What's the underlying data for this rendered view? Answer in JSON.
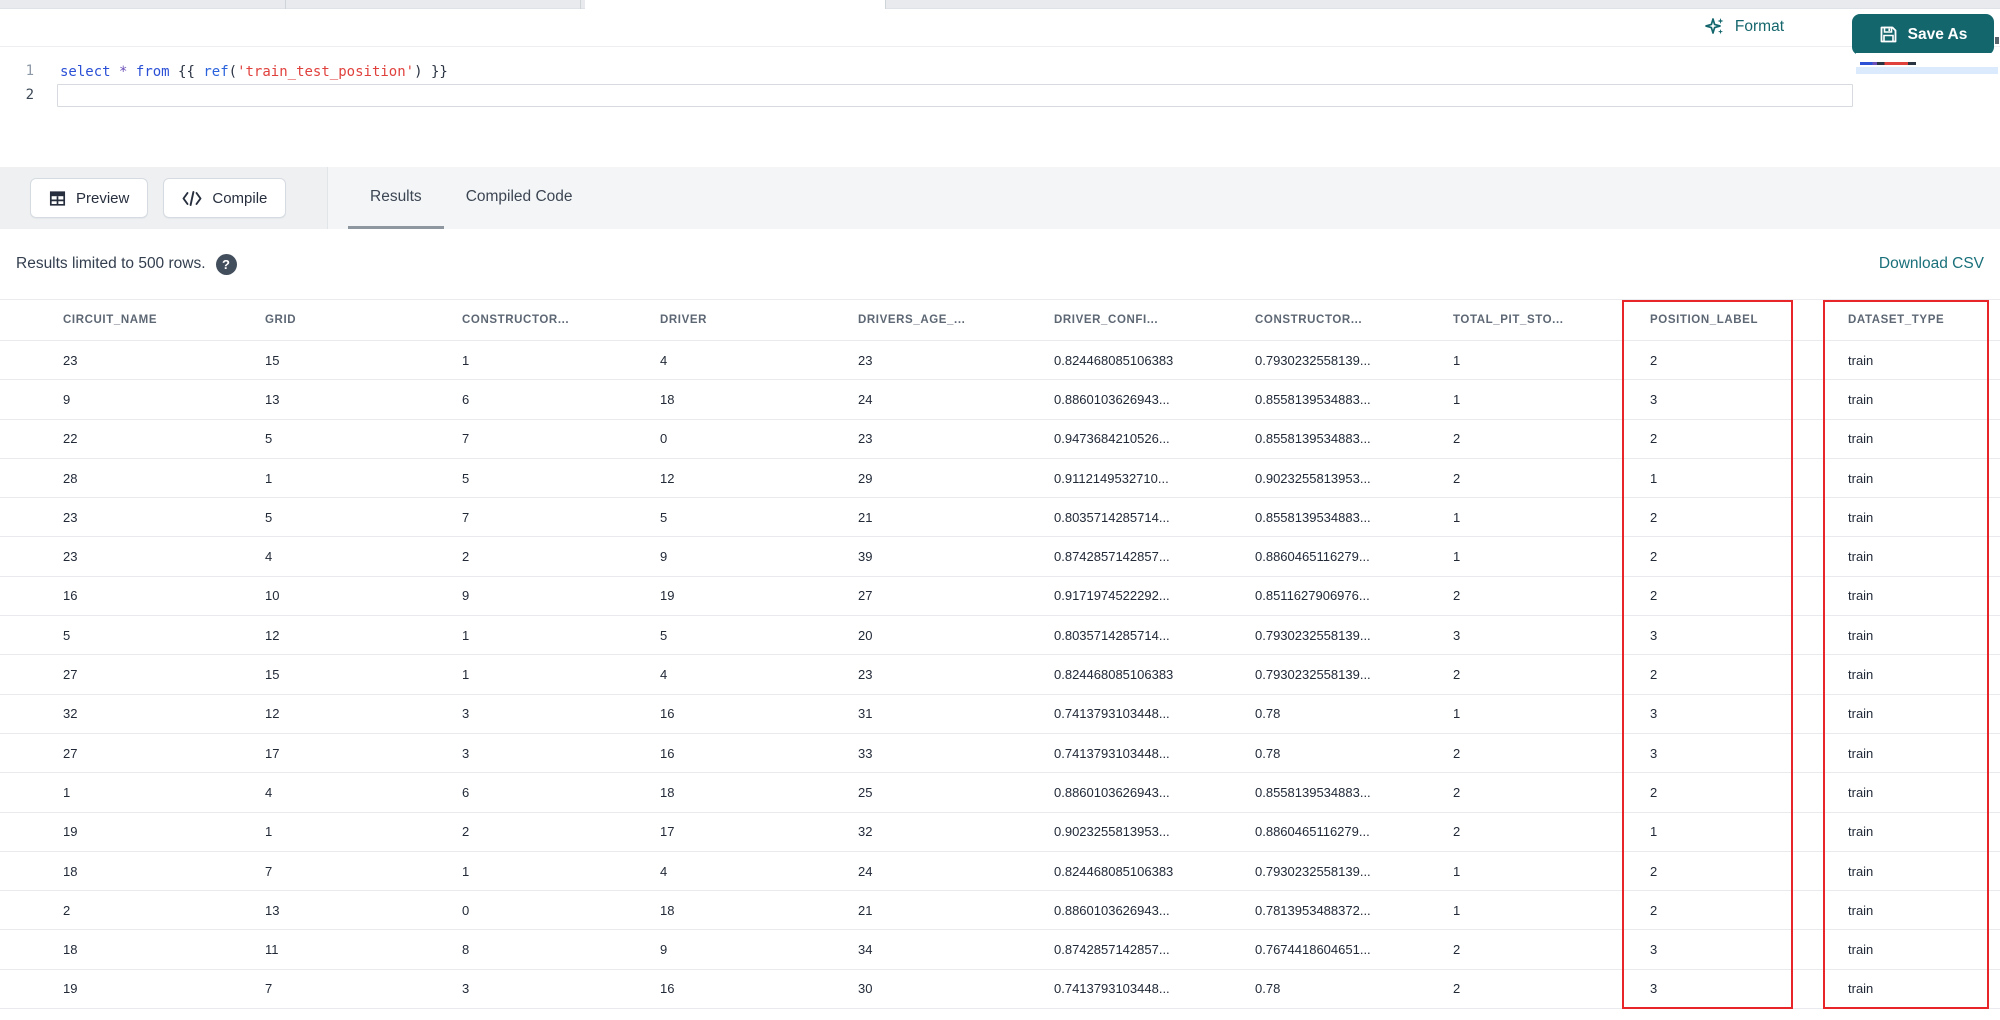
{
  "editor": {
    "line_numbers": [
      "1",
      "2"
    ],
    "code_line": "select * from {{ ref('train_test_position') }}",
    "line1_tokens": [
      {
        "text": "select",
        "type": "keyword"
      },
      {
        "text": " ",
        "type": "plain"
      },
      {
        "text": "*",
        "type": "operator"
      },
      {
        "text": " ",
        "type": "plain"
      },
      {
        "text": "from",
        "type": "keyword"
      },
      {
        "text": " ",
        "type": "plain"
      },
      {
        "text": "{{",
        "type": "jinja"
      },
      {
        "text": " ",
        "type": "plain"
      },
      {
        "text": "ref",
        "type": "function"
      },
      {
        "text": "(",
        "type": "plain"
      },
      {
        "text": "'train_test_position'",
        "type": "string"
      },
      {
        "text": ")",
        "type": "plain"
      },
      {
        "text": " ",
        "type": "plain"
      },
      {
        "text": "}}",
        "type": "jinja"
      }
    ]
  },
  "toolbar": {
    "format_label": "Format",
    "save_as_label": "Save As"
  },
  "actions": {
    "preview_label": "Preview",
    "compile_label": "Compile"
  },
  "results_panel": {
    "tabs": [
      {
        "label": "Results",
        "active": true
      },
      {
        "label": "Compiled Code",
        "active": false
      }
    ]
  },
  "status": {
    "message": "Results limited to 500 rows.",
    "help_icon": "?",
    "download_label": "Download CSV"
  },
  "table": {
    "columns": [
      "CIRCUIT_NAME",
      "GRID",
      "CONSTRUCTOR...",
      "DRIVER",
      "DRIVERS_AGE_...",
      "DRIVER_CONFI...",
      "CONSTRUCTOR...",
      "TOTAL_PIT_STO...",
      "POSITION_LABEL",
      "DATASET_TYPE"
    ],
    "rows": [
      [
        "23",
        "15",
        "1",
        "4",
        "23",
        "0.824468085106383",
        "0.7930232558139...",
        "1",
        "2",
        "train"
      ],
      [
        "9",
        "13",
        "6",
        "18",
        "24",
        "0.8860103626943...",
        "0.8558139534883...",
        "1",
        "3",
        "train"
      ],
      [
        "22",
        "5",
        "7",
        "0",
        "23",
        "0.9473684210526...",
        "0.8558139534883...",
        "2",
        "2",
        "train"
      ],
      [
        "28",
        "1",
        "5",
        "12",
        "29",
        "0.9112149532710...",
        "0.9023255813953...",
        "2",
        "1",
        "train"
      ],
      [
        "23",
        "5",
        "7",
        "5",
        "21",
        "0.8035714285714...",
        "0.8558139534883...",
        "1",
        "2",
        "train"
      ],
      [
        "23",
        "4",
        "2",
        "9",
        "39",
        "0.8742857142857...",
        "0.8860465116279...",
        "1",
        "2",
        "train"
      ],
      [
        "16",
        "10",
        "9",
        "19",
        "27",
        "0.9171974522292...",
        "0.8511627906976...",
        "2",
        "2",
        "train"
      ],
      [
        "5",
        "12",
        "1",
        "5",
        "20",
        "0.8035714285714...",
        "0.7930232558139...",
        "3",
        "3",
        "train"
      ],
      [
        "27",
        "15",
        "1",
        "4",
        "23",
        "0.824468085106383",
        "0.7930232558139...",
        "2",
        "2",
        "train"
      ],
      [
        "32",
        "12",
        "3",
        "16",
        "31",
        "0.7413793103448...",
        "0.78",
        "1",
        "3",
        "train"
      ],
      [
        "27",
        "17",
        "3",
        "16",
        "33",
        "0.7413793103448...",
        "0.78",
        "2",
        "3",
        "train"
      ],
      [
        "1",
        "4",
        "6",
        "18",
        "25",
        "0.8860103626943...",
        "0.8558139534883...",
        "2",
        "2",
        "train"
      ],
      [
        "19",
        "1",
        "2",
        "17",
        "32",
        "0.9023255813953...",
        "0.8860465116279...",
        "2",
        "1",
        "train"
      ],
      [
        "18",
        "7",
        "1",
        "4",
        "24",
        "0.824468085106383",
        "0.7930232558139...",
        "1",
        "2",
        "train"
      ],
      [
        "2",
        "13",
        "0",
        "18",
        "21",
        "0.8860103626943...",
        "0.7813953488372...",
        "1",
        "2",
        "train"
      ],
      [
        "18",
        "11",
        "8",
        "9",
        "34",
        "0.8742857142857...",
        "0.7674418604651...",
        "2",
        "3",
        "train"
      ],
      [
        "19",
        "7",
        "3",
        "16",
        "30",
        "0.7413793103448...",
        "0.78",
        "2",
        "3",
        "train"
      ]
    ]
  },
  "highlight": {
    "color": "#e8262a",
    "highlighted_columns": [
      "POSITION_LABEL",
      "DATASET_TYPE"
    ]
  },
  "colors": {
    "accent_teal": "#14666d",
    "link_teal": "#19707a",
    "keyword_blue": "#2b50d6",
    "string_red": "#e0413d"
  }
}
